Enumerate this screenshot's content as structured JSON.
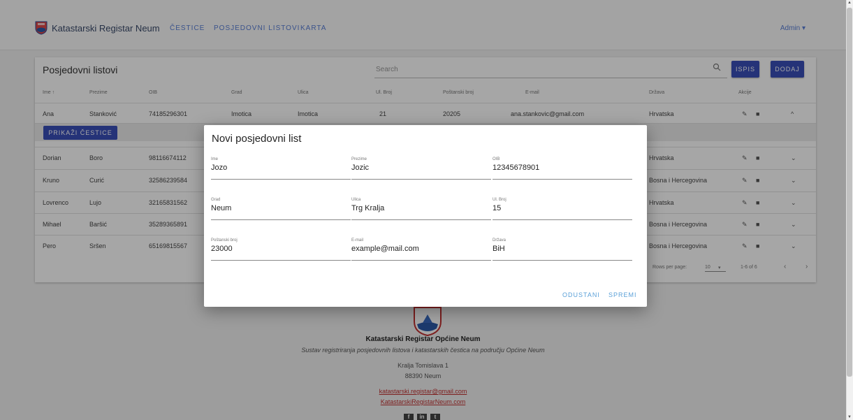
{
  "nav": {
    "brand": "Katastarski Registar Neum",
    "links": [
      "ČESTICE",
      "POSJEDOVNI LISTOVI",
      "KARTA"
    ],
    "user": "Admin ▾"
  },
  "card": {
    "title": "Posjedovni listovi",
    "search_placeholder": "Search",
    "btn_ispis": "ISPIS",
    "btn_dodaj": "DODAJ"
  },
  "table": {
    "headers": [
      "Ime ↑",
      "Prezime",
      "OIB",
      "Grad",
      "Ulica",
      "Ul. Broj",
      "Poštanski broj",
      "E-mail",
      "Država",
      "Akcije"
    ],
    "rows": [
      {
        "ime": "Ana",
        "prezime": "Stanković",
        "oib": "74185296301",
        "grad": "Imotica",
        "ulica": "Imotica",
        "broj": "21",
        "postanski": "20205",
        "email": "ana.stankovic@gmail.com",
        "drzava": "Hrvatska"
      },
      {
        "ime": "Dorian",
        "prezime": "Boro",
        "oib": "98116674112",
        "drzava": "Hrvatska"
      },
      {
        "ime": "Kruno",
        "prezime": "Curić",
        "oib": "32586239584",
        "drzava": "Bosna i Hercegovina"
      },
      {
        "ime": "Lovrenco",
        "prezime": "Lujo",
        "oib": "32165831562",
        "drzava": "Hrvatska"
      },
      {
        "ime": "Mihael",
        "prezime": "Baršić",
        "oib": "35289365891",
        "drzava": "Bosna i Hercegovina"
      },
      {
        "ime": "Pero",
        "prezime": "Sršen",
        "oib": "65169815567",
        "drzava": "Bosna i Hercegovina"
      }
    ],
    "expand_button": "PRIKAŽI ČESTICE",
    "rows_per_page_label": "Rows per page:",
    "rows_per_page_value": "10",
    "range": "1-6 of 6"
  },
  "footer": {
    "title": "Katastarski Registar Općine Neum",
    "subtitle": "Sustav registriranja posjedovnih listova i katastarskih čestica na području Općine Neum",
    "address1": "Kralja Tomislava 1",
    "address2": "88390 Neum",
    "email": "katastarski.registar@gmail.com",
    "site": "KatastarskiRegistarNeum.com"
  },
  "dialog": {
    "title": "Novi posjedovni list",
    "fields": [
      {
        "label": "Ime",
        "value": "Jozo"
      },
      {
        "label": "Prezime",
        "value": "Jozic"
      },
      {
        "label": "OIB",
        "value": "12345678901"
      },
      {
        "label": "Grad",
        "value": "Neum"
      },
      {
        "label": "Ulica",
        "value": "Trg Kralja"
      },
      {
        "label": "Ul. Broj",
        "value": "15"
      },
      {
        "label": "Poštanski broj",
        "value": "23000"
      },
      {
        "label": "E-mail",
        "value": "example@mail.com"
      },
      {
        "label": "Država",
        "value": "BiH"
      }
    ],
    "cancel": "ODUSTANI",
    "save": "SPREMI"
  },
  "colors": {
    "primary": "#3a4fb8",
    "link": "#5a7fd6",
    "dialog_action": "#5aa0d8"
  }
}
